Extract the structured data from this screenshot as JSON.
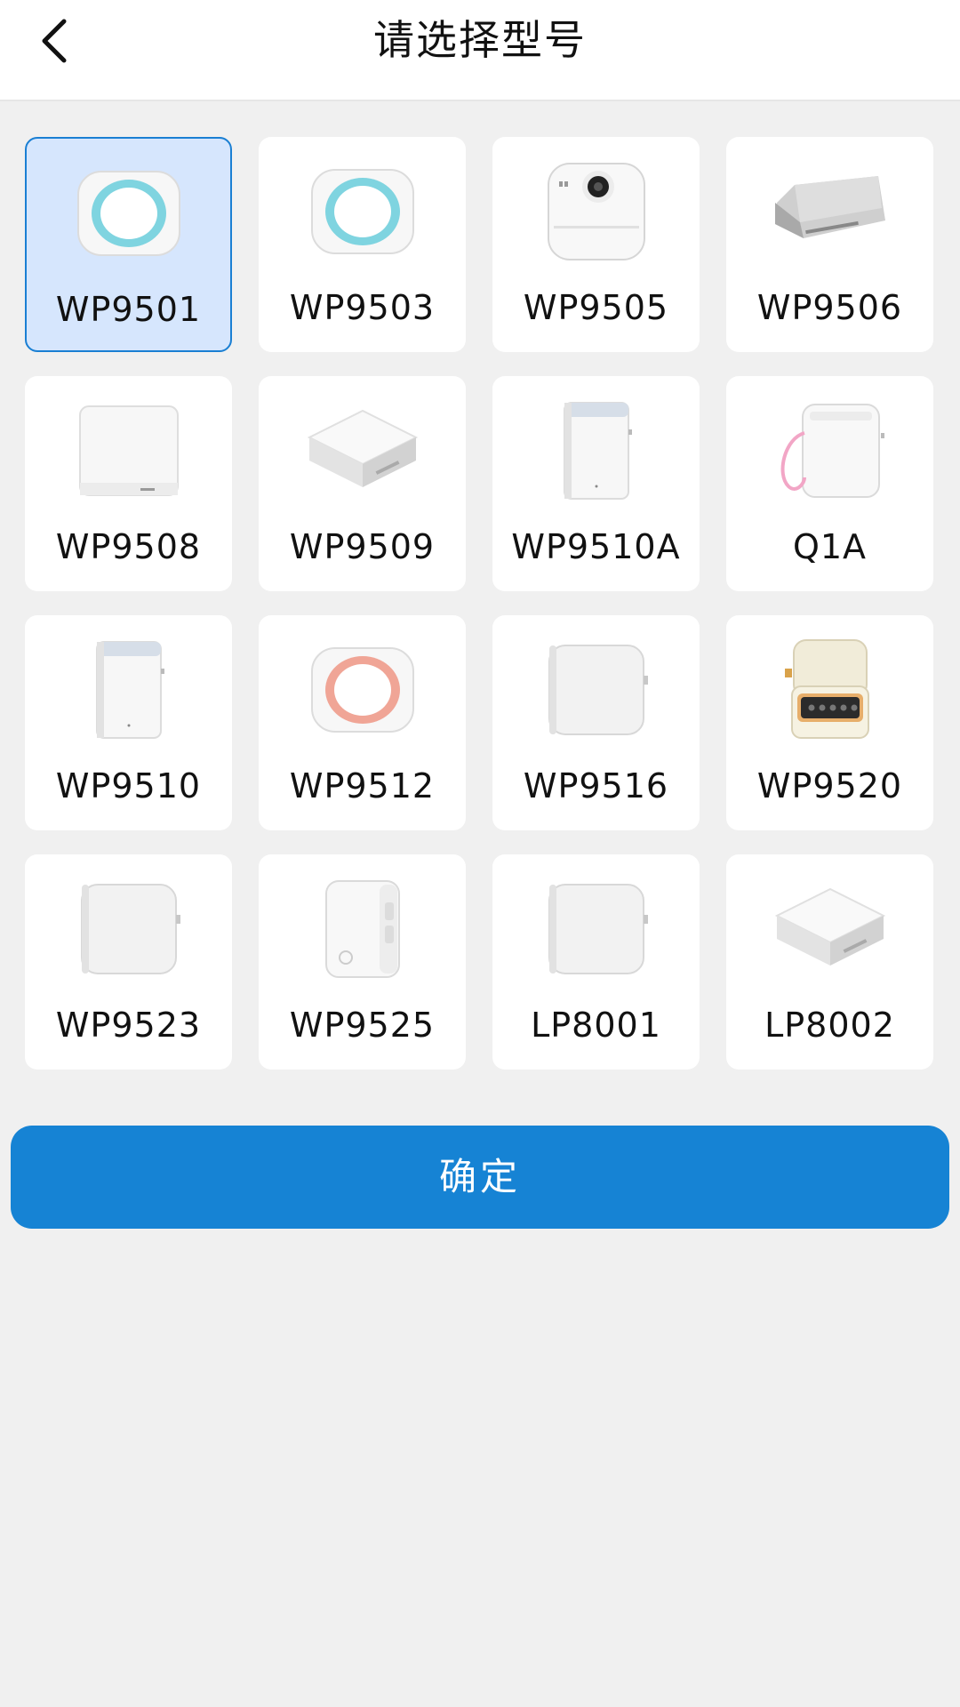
{
  "header": {
    "title": "请选择型号"
  },
  "models": [
    {
      "label": "WP9501",
      "icon": "round-printer-blue-icon",
      "selected": true
    },
    {
      "label": "WP9503",
      "icon": "round-printer-blue-icon",
      "selected": false
    },
    {
      "label": "WP9505",
      "icon": "camera-printer-icon",
      "selected": false
    },
    {
      "label": "WP9506",
      "icon": "flat-gray-printer-icon",
      "selected": false
    },
    {
      "label": "WP9508",
      "icon": "white-box-printer-icon",
      "selected": false
    },
    {
      "label": "WP9509",
      "icon": "square-flat-printer-icon",
      "selected": false
    },
    {
      "label": "WP9510A",
      "icon": "tall-printer-icon",
      "selected": false
    },
    {
      "label": "Q1A",
      "icon": "printer-with-strap-icon",
      "selected": false
    },
    {
      "label": "WP9510",
      "icon": "tall-printer-icon",
      "selected": false
    },
    {
      "label": "WP9512",
      "icon": "round-printer-pink-icon",
      "selected": false
    },
    {
      "label": "WP9516",
      "icon": "rounded-cube-printer-icon",
      "selected": false
    },
    {
      "label": "WP9520",
      "icon": "retro-printer-icon",
      "selected": false
    },
    {
      "label": "WP9523",
      "icon": "rounded-cube-printer-icon",
      "selected": false
    },
    {
      "label": "WP9525",
      "icon": "label-printer-icon",
      "selected": false
    },
    {
      "label": "LP8001",
      "icon": "rounded-cube-printer-icon",
      "selected": false
    },
    {
      "label": "LP8002",
      "icon": "square-flat-printer-icon",
      "selected": false
    }
  ],
  "confirm_label": "确定",
  "colors": {
    "accent": "#1683d4",
    "selected_bg": "#d6e6fd",
    "selected_border": "#1a7fd3",
    "page_bg": "#f0f0f0"
  }
}
